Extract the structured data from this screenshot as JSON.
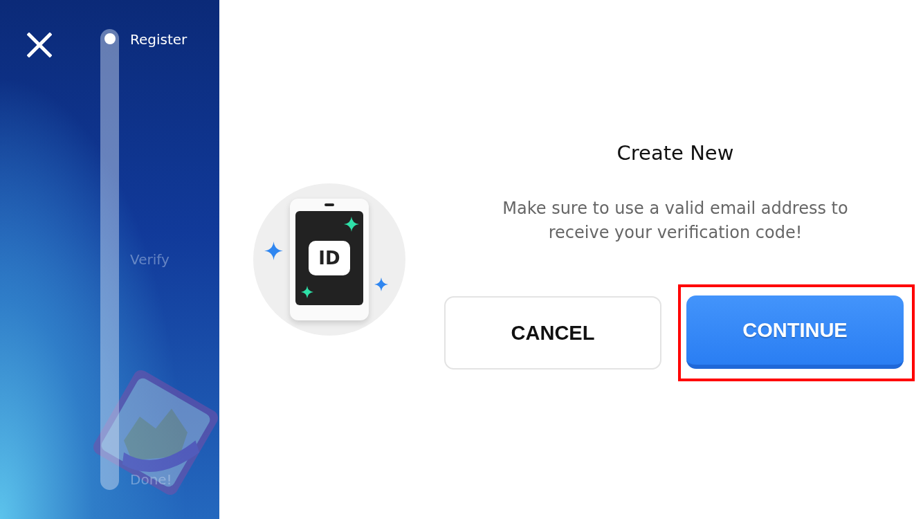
{
  "steps": [
    {
      "label": "Register",
      "selected": true
    },
    {
      "label": "Verify",
      "selected": false
    },
    {
      "label": "Done!",
      "selected": false
    }
  ],
  "dialog": {
    "title": "Create New",
    "message": "Make sure to use a valid email address to receive your verification code!",
    "id_badge": "ID",
    "buttons": [
      {
        "label": "CANCEL",
        "kind": "secondary",
        "highlighted": false
      },
      {
        "label": "CONTINUE",
        "kind": "primary",
        "highlighted": true
      }
    ]
  }
}
